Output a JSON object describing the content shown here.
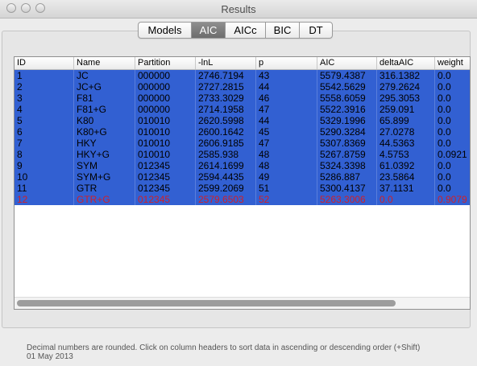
{
  "window": {
    "title": "Results"
  },
  "tabs": [
    {
      "label": "Models",
      "active": false
    },
    {
      "label": "AIC",
      "active": true
    },
    {
      "label": "AICc",
      "active": false
    },
    {
      "label": "BIC",
      "active": false
    },
    {
      "label": "DT",
      "active": false
    }
  ],
  "table": {
    "columns": [
      "ID",
      "Name",
      "Partition",
      "-lnL",
      "p",
      "AIC",
      "deltaAIC",
      "weight"
    ],
    "rows": [
      [
        "1",
        "JC",
        "000000",
        "2746.7194",
        "43",
        "5579.4387",
        "316.1382",
        "0.0"
      ],
      [
        "2",
        "JC+G",
        "000000",
        "2727.2815",
        "44",
        "5542.5629",
        "279.2624",
        "0.0"
      ],
      [
        "3",
        "F81",
        "000000",
        "2733.3029",
        "46",
        "5558.6059",
        "295.3053",
        "0.0"
      ],
      [
        "4",
        "F81+G",
        "000000",
        "2714.1958",
        "47",
        "5522.3916",
        "259.091",
        "0.0"
      ],
      [
        "5",
        "K80",
        "010010",
        "2620.5998",
        "44",
        "5329.1996",
        "65.899",
        "0.0"
      ],
      [
        "6",
        "K80+G",
        "010010",
        "2600.1642",
        "45",
        "5290.3284",
        "27.0278",
        "0.0"
      ],
      [
        "7",
        "HKY",
        "010010",
        "2606.9185",
        "47",
        "5307.8369",
        "44.5363",
        "0.0"
      ],
      [
        "8",
        "HKY+G",
        "010010",
        "2585.938",
        "48",
        "5267.8759",
        "4.5753",
        "0.0921"
      ],
      [
        "9",
        "SYM",
        "012345",
        "2614.1699",
        "48",
        "5324.3398",
        "61.0392",
        "0.0"
      ],
      [
        "10",
        "SYM+G",
        "012345",
        "2594.4435",
        "49",
        "5286.887",
        "23.5864",
        "0.0"
      ],
      [
        "11",
        "GTR",
        "012345",
        "2599.2069",
        "51",
        "5300.4137",
        "37.1131",
        "0.0"
      ],
      [
        "12",
        "GTR+G",
        "012345",
        "2579.6503",
        "52",
        "5263.3006",
        "0.0",
        "0.9079"
      ]
    ],
    "highlight_color": "#3260d2",
    "best_model_text_color": "#d0202a"
  },
  "footer": {
    "note": "Decimal numbers are rounded. Click on column headers to sort data in ascending or descending order (+Shift)",
    "date": "01 May 2013"
  }
}
